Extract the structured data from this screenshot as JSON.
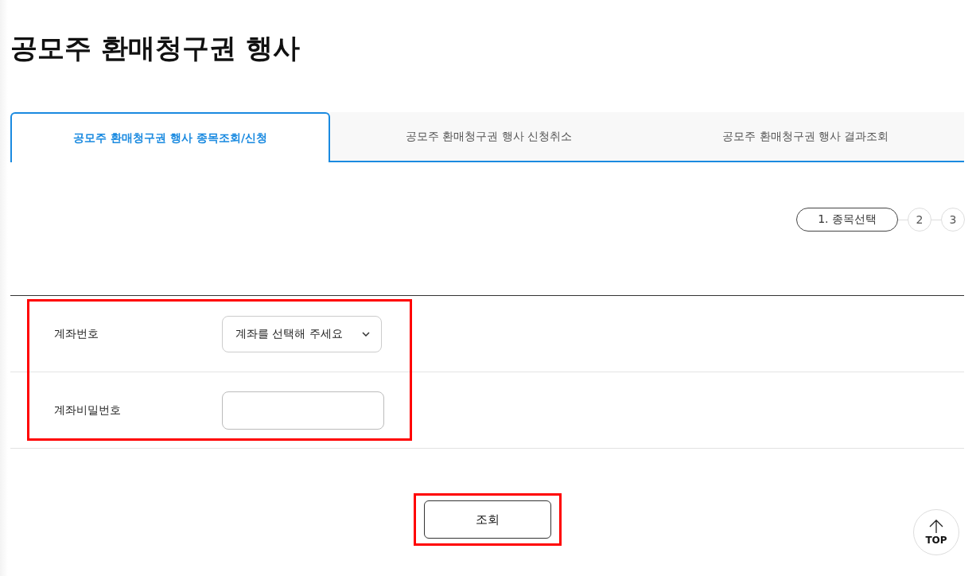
{
  "page_title": "공모주 환매청구권 행사",
  "tabs": [
    {
      "label": "공모주 환매청구권 행사 종목조회/신청",
      "selected": true
    },
    {
      "label": "공모주 환매청구권 행사 신청취소",
      "selected": false
    },
    {
      "label": "공모주 환매청구권 행사 결과조회",
      "selected": false
    }
  ],
  "steps": [
    {
      "label": "1. 종목선택",
      "selected": true
    },
    {
      "label": "2",
      "selected": false
    },
    {
      "label": "3",
      "selected": false
    }
  ],
  "form": {
    "highlighted": true,
    "fields": [
      {
        "kind": "select",
        "label": "계좌번호",
        "value": "계좌를 선택해 주세요"
      },
      {
        "kind": "password",
        "label": "계좌비밀번호"
      }
    ]
  },
  "search_button": {
    "label": "조회",
    "highlighted": true
  },
  "top_button": {
    "label": "TOP"
  }
}
